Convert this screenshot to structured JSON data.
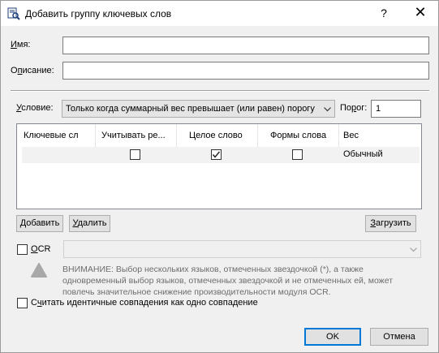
{
  "window": {
    "title": "Добавить группу ключевых слов",
    "help_glyph": "?",
    "close_glyph": "✕"
  },
  "fields": {
    "name_label": "Имя:",
    "name_value": "",
    "description_label": "Описание:",
    "description_value": ""
  },
  "condition": {
    "label": "Условие:",
    "selected": "Только когда суммарный вес превышает (или равен) порогу",
    "threshold_label": "Порог:",
    "threshold_value": "1"
  },
  "table": {
    "columns": [
      "Ключевые сл",
      "Учитывать ре...",
      "Целое слово",
      "Формы слова",
      "Вес"
    ],
    "rows": [
      {
        "keyword": "",
        "match_case": false,
        "whole_word": true,
        "word_forms": false,
        "weight": "Обычный"
      }
    ]
  },
  "buttons": {
    "add": "Добавить",
    "remove": "Удалить",
    "load": "Загрузить",
    "ok": "OK",
    "cancel": "Отмена"
  },
  "ocr": {
    "label": "OCR",
    "checked": false,
    "selected": "",
    "warning": "ВНИМАНИЕ: Выбор нескольких языков, отмеченных звездочкой (*), а также одновременный выбор языков, отмеченных звездочкой и не отмеченных ей, может повлечь значительное снижение производительности модуля OCR."
  },
  "identical_matches": {
    "label": "Считать идентичные совпадения как одно совпадение",
    "checked": false
  },
  "colors": {
    "default_button_border": "#0078d7",
    "window_bg": "#f0f0f0"
  }
}
